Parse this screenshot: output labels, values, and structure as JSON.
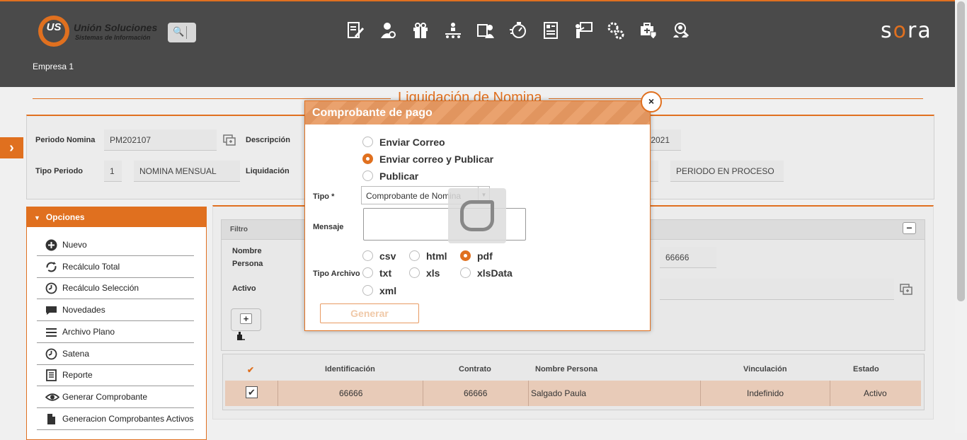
{
  "header": {
    "logo_mono": "US",
    "logo_title": "Unión Soluciones",
    "logo_subtitle": "Sistemas de Información",
    "search_glyph": "🔍",
    "brand_a": "s",
    "brand_b": "o",
    "brand_c": "ra",
    "company": "Empresa 1",
    "icons": [
      "edit-document-icon",
      "person-settings-icon",
      "gift-icon",
      "org-chart-icon",
      "id-card-person-icon",
      "timer-icon",
      "document-list-icon",
      "presentation-icon",
      "gears-icon",
      "medical-kit-icon",
      "group-search-icon"
    ]
  },
  "page": {
    "title": "Liquidación de Nomina",
    "toggle_glyph": "›"
  },
  "form": {
    "periodo_label": "Periodo Nomina",
    "periodo_value": "PM202107",
    "descripcion_label": "Descripción",
    "fecha_value": "/2021",
    "tipo_periodo_label": "Tipo Periodo",
    "tipo_periodo_code": "1",
    "tipo_periodo_name": "NOMINA MENSUAL",
    "liquidacion_label": "Liquidación",
    "estado_value": "PERIODO EN PROCESO"
  },
  "options": {
    "title": "Opciones",
    "items": [
      {
        "label": "Nuevo",
        "icon": "plus-circle-icon"
      },
      {
        "label": "Recálculo Total",
        "icon": "refresh-icon"
      },
      {
        "label": "Recálculo Selección",
        "icon": "clock-icon"
      },
      {
        "label": "Novedades",
        "icon": "comment-icon"
      },
      {
        "label": "Archivo Plano",
        "icon": "lines-icon"
      },
      {
        "label": "Satena",
        "icon": "clock-icon"
      },
      {
        "label": "Reporte",
        "icon": "report-icon"
      },
      {
        "label": "Generar Comprobante",
        "icon": "eye-icon"
      },
      {
        "label": "Generacion Comprobantes Activos",
        "icon": "document-icon"
      }
    ]
  },
  "filter": {
    "title": "Filtro",
    "collapse_glyph": "−",
    "nombre_label_1": "Nombre",
    "nombre_label_2": "Persona",
    "activo_label": "Activo",
    "id_value": "66666",
    "add_glyph": "+"
  },
  "table": {
    "check_header": "✔",
    "columns": [
      "Identificación",
      "Contrato",
      "Nombre Persona",
      "Vinculación",
      "Estado"
    ],
    "rows": [
      {
        "checked": "✔",
        "identificacion": "66666",
        "contrato": "66666",
        "nombre": "Salgado Paula",
        "vinculacion": "Indefinido",
        "estado": "Activo"
      }
    ]
  },
  "modal": {
    "title": "Comprobante de pago",
    "close_glyph": "×",
    "send_options": [
      {
        "label": "Enviar Correo",
        "selected": false
      },
      {
        "label": "Enviar correo y Publicar",
        "selected": true
      },
      {
        "label": "Publicar",
        "selected": false
      }
    ],
    "tipo_label": "Tipo *",
    "tipo_value": "Comprobante de Nomina",
    "tipo_arrow": "▼",
    "mensaje_label": "Mensaje",
    "mensaje_value": "",
    "tipo_archivo_label": "Tipo Archivo",
    "file_types": [
      {
        "label": "csv",
        "selected": false
      },
      {
        "label": "html",
        "selected": false
      },
      {
        "label": "pdf",
        "selected": true
      },
      {
        "label": "txt",
        "selected": false
      },
      {
        "label": "xls",
        "selected": false
      },
      {
        "label": "xlsData",
        "selected": false
      },
      {
        "label": "xml",
        "selected": false
      }
    ],
    "generate_label": "Generar"
  },
  "colors": {
    "accent": "#e0701f",
    "topbar": "#4a4a4a",
    "selected_row": "#e8cbb8"
  }
}
